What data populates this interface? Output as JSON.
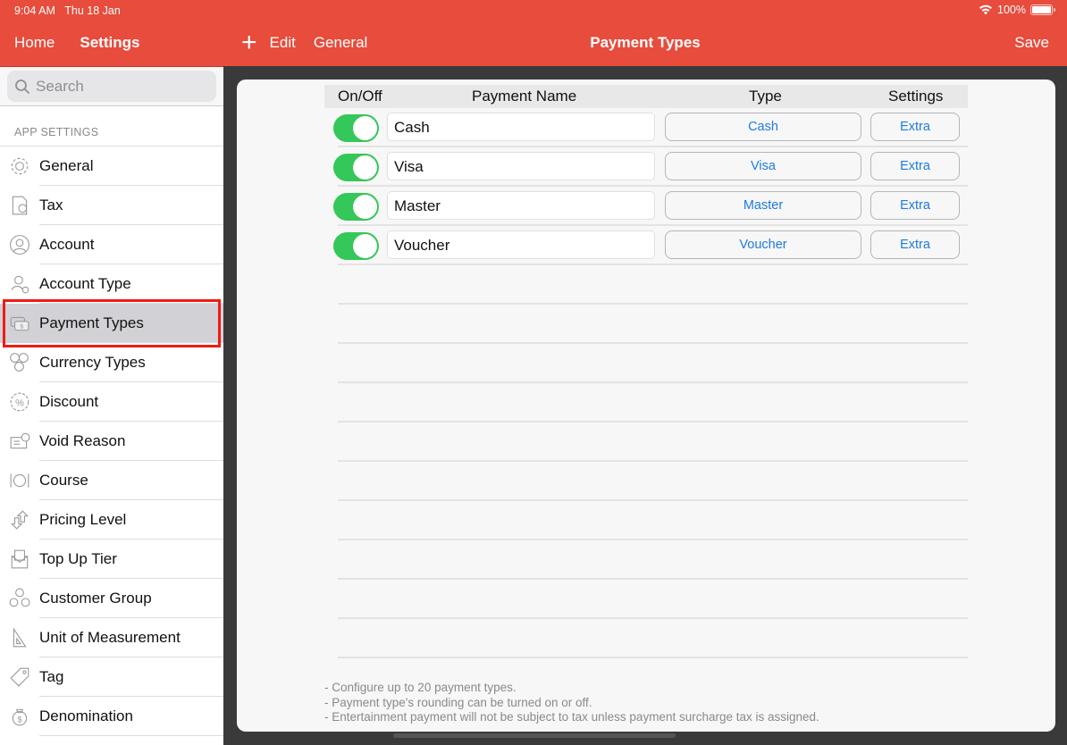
{
  "status_bar": {
    "time": "9:04 AM",
    "date": "Thu 18 Jan",
    "battery": "100%"
  },
  "sidebar_nav": {
    "home": "Home",
    "settings": "Settings"
  },
  "main_nav": {
    "edit": "Edit",
    "general": "General",
    "title": "Payment Types",
    "save": "Save"
  },
  "search": {
    "placeholder": "Search"
  },
  "sidebar": {
    "section": "APP SETTINGS",
    "items": [
      {
        "label": "General",
        "icon": "gear-icon"
      },
      {
        "label": "Tax",
        "icon": "tax-document-icon"
      },
      {
        "label": "Account",
        "icon": "person-icon"
      },
      {
        "label": "Account Type",
        "icon": "person-gear-icon"
      },
      {
        "label": "Payment Types",
        "icon": "cash-icon",
        "selected": true
      },
      {
        "label": "Currency Types",
        "icon": "currency-icon"
      },
      {
        "label": "Discount",
        "icon": "percent-badge-icon"
      },
      {
        "label": "Void Reason",
        "icon": "void-ticket-icon"
      },
      {
        "label": "Course",
        "icon": "plate-cutlery-icon"
      },
      {
        "label": "Pricing Level",
        "icon": "up-down-arrows-icon"
      },
      {
        "label": "Top Up Tier",
        "icon": "envelope-dollar-icon"
      },
      {
        "label": "Customer Group",
        "icon": "group-icon"
      },
      {
        "label": "Unit of Measurement",
        "icon": "ruler-triangle-icon"
      },
      {
        "label": "Tag",
        "icon": "tag-icon"
      },
      {
        "label": "Denomination",
        "icon": "money-bag-icon"
      }
    ]
  },
  "table": {
    "headers": {
      "on_off": "On/Off",
      "name": "Payment Name",
      "type": "Type",
      "settings": "Settings"
    },
    "rows": [
      {
        "enabled": true,
        "name": "Cash",
        "type": "Cash",
        "settings": "Extra"
      },
      {
        "enabled": true,
        "name": "Visa",
        "type": "Visa",
        "settings": "Extra"
      },
      {
        "enabled": true,
        "name": "Master",
        "type": "Master",
        "settings": "Extra"
      },
      {
        "enabled": true,
        "name": "Voucher",
        "type": "Voucher",
        "settings": "Extra"
      }
    ]
  },
  "notes": [
    "- Configure up to 20 payment types.",
    "- Payment type's rounding can be turned on or off.",
    "- Entertainment payment will not be subject to tax unless payment surcharge tax is assigned."
  ],
  "colors": {
    "brand": "#e74c3c",
    "toggle_on": "#34c759",
    "link": "#1f7ae0",
    "selection_outline": "#ee1c14"
  }
}
